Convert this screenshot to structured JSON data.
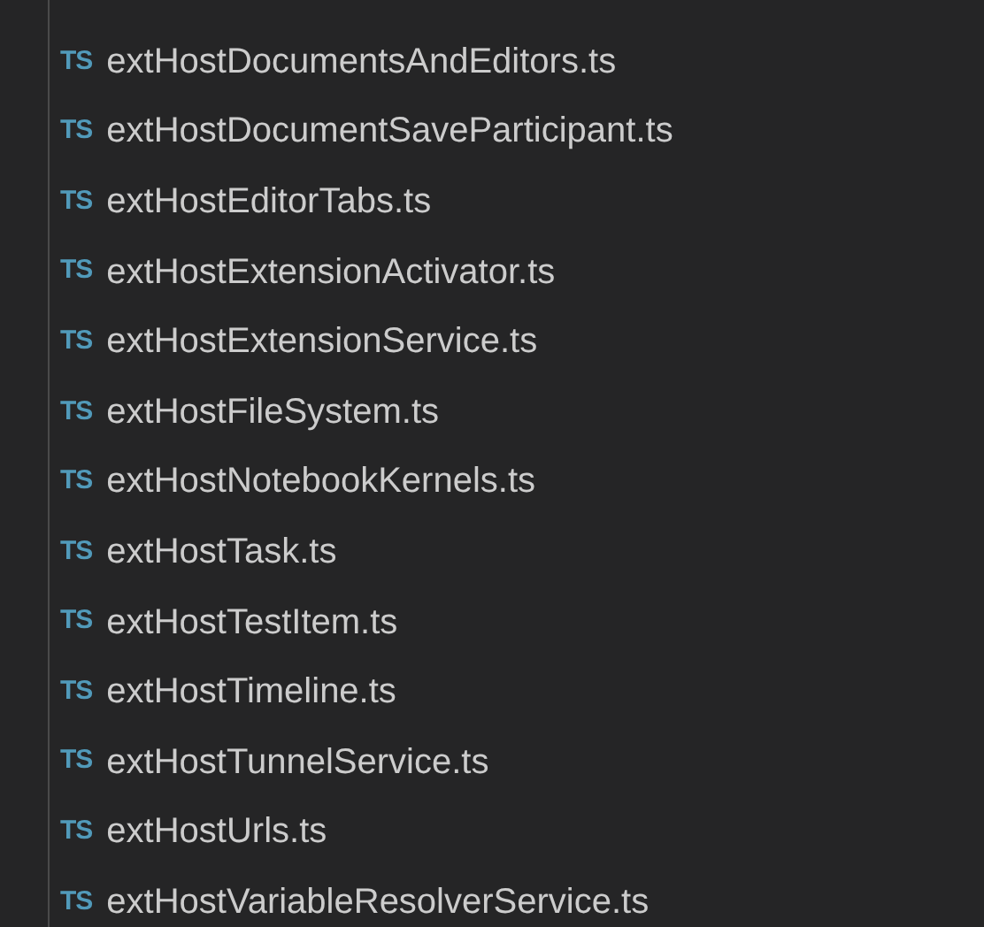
{
  "files": [
    {
      "icon": "TS",
      "name": "extHostDocumentsAndEditors.ts"
    },
    {
      "icon": "TS",
      "name": "extHostDocumentSaveParticipant.ts"
    },
    {
      "icon": "TS",
      "name": "extHostEditorTabs.ts"
    },
    {
      "icon": "TS",
      "name": "extHostExtensionActivator.ts"
    },
    {
      "icon": "TS",
      "name": "extHostExtensionService.ts"
    },
    {
      "icon": "TS",
      "name": "extHostFileSystem.ts"
    },
    {
      "icon": "TS",
      "name": "extHostNotebookKernels.ts"
    },
    {
      "icon": "TS",
      "name": "extHostTask.ts"
    },
    {
      "icon": "TS",
      "name": "extHostTestItem.ts"
    },
    {
      "icon": "TS",
      "name": "extHostTimeline.ts"
    },
    {
      "icon": "TS",
      "name": "extHostTunnelService.ts"
    },
    {
      "icon": "TS",
      "name": "extHostUrls.ts"
    },
    {
      "icon": "TS",
      "name": "extHostVariableResolverService.ts"
    }
  ]
}
